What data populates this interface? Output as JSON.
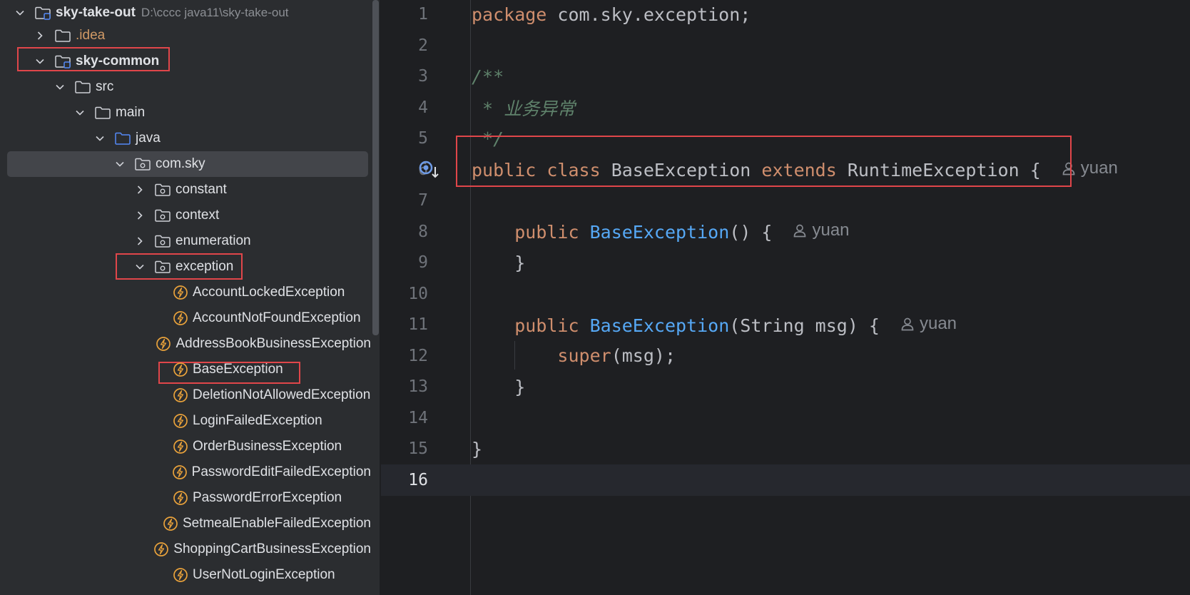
{
  "project_tree": {
    "rows": [
      {
        "label": "sky-take-out",
        "path": "D:\\cccc java11\\sky-take-out",
        "type": "module",
        "expanded": true
      },
      {
        "label": ".idea",
        "type": "folder",
        "expanded": false
      },
      {
        "label": "sky-common",
        "type": "module",
        "expanded": true
      },
      {
        "label": "src",
        "type": "folder",
        "expanded": true
      },
      {
        "label": "main",
        "type": "folder",
        "expanded": true
      },
      {
        "label": "java",
        "type": "source-folder",
        "expanded": true
      },
      {
        "label": "com.sky",
        "type": "package",
        "expanded": true,
        "selected": true
      },
      {
        "label": "constant",
        "type": "package",
        "expanded": false
      },
      {
        "label": "context",
        "type": "package",
        "expanded": false
      },
      {
        "label": "enumeration",
        "type": "package",
        "expanded": false
      },
      {
        "label": "exception",
        "type": "package",
        "expanded": true
      },
      {
        "label": "AccountLockedException",
        "type": "exception-class"
      },
      {
        "label": "AccountNotFoundException",
        "type": "exception-class"
      },
      {
        "label": "AddressBookBusinessException",
        "type": "exception-class"
      },
      {
        "label": "BaseException",
        "type": "exception-class"
      },
      {
        "label": "DeletionNotAllowedException",
        "type": "exception-class"
      },
      {
        "label": "LoginFailedException",
        "type": "exception-class"
      },
      {
        "label": "OrderBusinessException",
        "type": "exception-class"
      },
      {
        "label": "PasswordEditFailedException",
        "type": "exception-class"
      },
      {
        "label": "PasswordErrorException",
        "type": "exception-class"
      },
      {
        "label": "SetmealEnableFailedException",
        "type": "exception-class"
      },
      {
        "label": "ShoppingCartBusinessException",
        "type": "exception-class"
      },
      {
        "label": "UserNotLoginException",
        "type": "exception-class"
      }
    ]
  },
  "editor": {
    "author": "yuan",
    "lines": [
      {
        "n": "1",
        "tokens": [
          {
            "t": "package",
            "c": "kw"
          },
          {
            "t": " com.sky.exception;",
            "c": "pl"
          }
        ]
      },
      {
        "n": "2",
        "tokens": []
      },
      {
        "n": "3",
        "tokens": [
          {
            "t": "/**",
            "c": "cm"
          }
        ]
      },
      {
        "n": "4",
        "tokens": [
          {
            "t": " * 业务异常",
            "c": "cm"
          }
        ]
      },
      {
        "n": "5",
        "tokens": [
          {
            "t": " */",
            "c": "cm"
          }
        ]
      },
      {
        "n": "6",
        "tokens": [
          {
            "t": "public",
            "c": "kw"
          },
          {
            "t": " ",
            "c": "pl"
          },
          {
            "t": "class",
            "c": "kw"
          },
          {
            "t": " BaseException ",
            "c": "pl"
          },
          {
            "t": "extends",
            "c": "kw"
          },
          {
            "t": " RuntimeException {",
            "c": "pl"
          }
        ],
        "author": true
      },
      {
        "n": "7",
        "tokens": []
      },
      {
        "n": "8",
        "tokens": [
          {
            "t": "    ",
            "c": "pl"
          },
          {
            "t": "public",
            "c": "kw"
          },
          {
            "t": " ",
            "c": "pl"
          },
          {
            "t": "BaseException",
            "c": "fn"
          },
          {
            "t": "() {",
            "c": "pl"
          }
        ],
        "author": true
      },
      {
        "n": "9",
        "tokens": [
          {
            "t": "    }",
            "c": "pl"
          }
        ]
      },
      {
        "n": "10",
        "tokens": []
      },
      {
        "n": "11",
        "tokens": [
          {
            "t": "    ",
            "c": "pl"
          },
          {
            "t": "public",
            "c": "kw"
          },
          {
            "t": " ",
            "c": "pl"
          },
          {
            "t": "BaseException",
            "c": "fn"
          },
          {
            "t": "(String msg) {",
            "c": "pl"
          }
        ],
        "author": true
      },
      {
        "n": "12",
        "tokens": [
          {
            "t": "        ",
            "c": "pl"
          },
          {
            "t": "super",
            "c": "kw"
          },
          {
            "t": "(msg);",
            "c": "pl"
          }
        ]
      },
      {
        "n": "13",
        "tokens": [
          {
            "t": "    }",
            "c": "pl"
          }
        ]
      },
      {
        "n": "14",
        "tokens": []
      },
      {
        "n": "15",
        "tokens": [
          {
            "t": "}",
            "c": "pl"
          }
        ]
      },
      {
        "n": "16",
        "tokens": [],
        "current": true
      }
    ]
  },
  "colors": {
    "highlight": "#e0464a",
    "keyword": "#cf8e6d",
    "comment": "#5f826b",
    "function": "#56a8f5"
  }
}
